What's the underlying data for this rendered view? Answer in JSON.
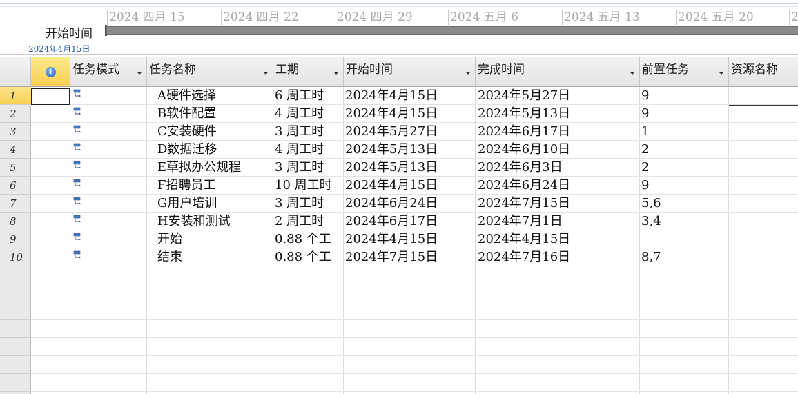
{
  "timeline": {
    "dates": [
      "2024 四月 15",
      "2024 四月 22",
      "2024 四月 29",
      "2024 五月 6",
      "2024 五月 13",
      "2024 五月 20",
      "2"
    ],
    "start_label": "开始时间",
    "start_date": "2024年4月15日"
  },
  "columns": {
    "info_icon": "info-icon",
    "task_mode": "任务模式",
    "task_name": "任务名称",
    "duration": "工期",
    "start": "开始时间",
    "finish": "完成时间",
    "predecessors": "前置任务",
    "resource": "资源名称"
  },
  "rows": [
    {
      "num": "1",
      "name": "A硬件选择",
      "duration": "6 周工时",
      "start": "2024年4月15日",
      "finish": "2024年5月27日",
      "pred": "9"
    },
    {
      "num": "2",
      "name": "B软件配置",
      "duration": "4 周工时",
      "start": "2024年4月15日",
      "finish": "2024年5月13日",
      "pred": "9"
    },
    {
      "num": "3",
      "name": "C安装硬件",
      "duration": "3 周工时",
      "start": "2024年5月27日",
      "finish": "2024年6月17日",
      "pred": "1"
    },
    {
      "num": "4",
      "name": "D数据迁移",
      "duration": "4 周工时",
      "start": "2024年5月13日",
      "finish": "2024年6月10日",
      "pred": "2"
    },
    {
      "num": "5",
      "name": "E草拟办公规程",
      "duration": "3 周工时",
      "start": "2024年5月13日",
      "finish": "2024年6月3日",
      "pred": "2"
    },
    {
      "num": "6",
      "name": "F招聘员工",
      "duration": "10 周工时",
      "start": "2024年4月15日",
      "finish": "2024年6月24日",
      "pred": "9"
    },
    {
      "num": "7",
      "name": "G用户培训",
      "duration": "3 周工时",
      "start": "2024年6月24日",
      "finish": "2024年7月15日",
      "pred": "5,6"
    },
    {
      "num": "8",
      "name": "H安装和测试",
      "duration": "2 周工时",
      "start": "2024年6月17日",
      "finish": "2024年7月1日",
      "pred": "3,4"
    },
    {
      "num": "9",
      "name": "开始",
      "duration": "0.88 个工",
      "start": "2024年4月15日",
      "finish": "2024年4月15日",
      "pred": ""
    },
    {
      "num": "10",
      "name": "结束",
      "duration": "0.88 个工",
      "start": "2024年7月15日",
      "finish": "2024年7月16日",
      "pred": "8,7"
    }
  ],
  "task_mode_icon": "auto-schedule-icon"
}
